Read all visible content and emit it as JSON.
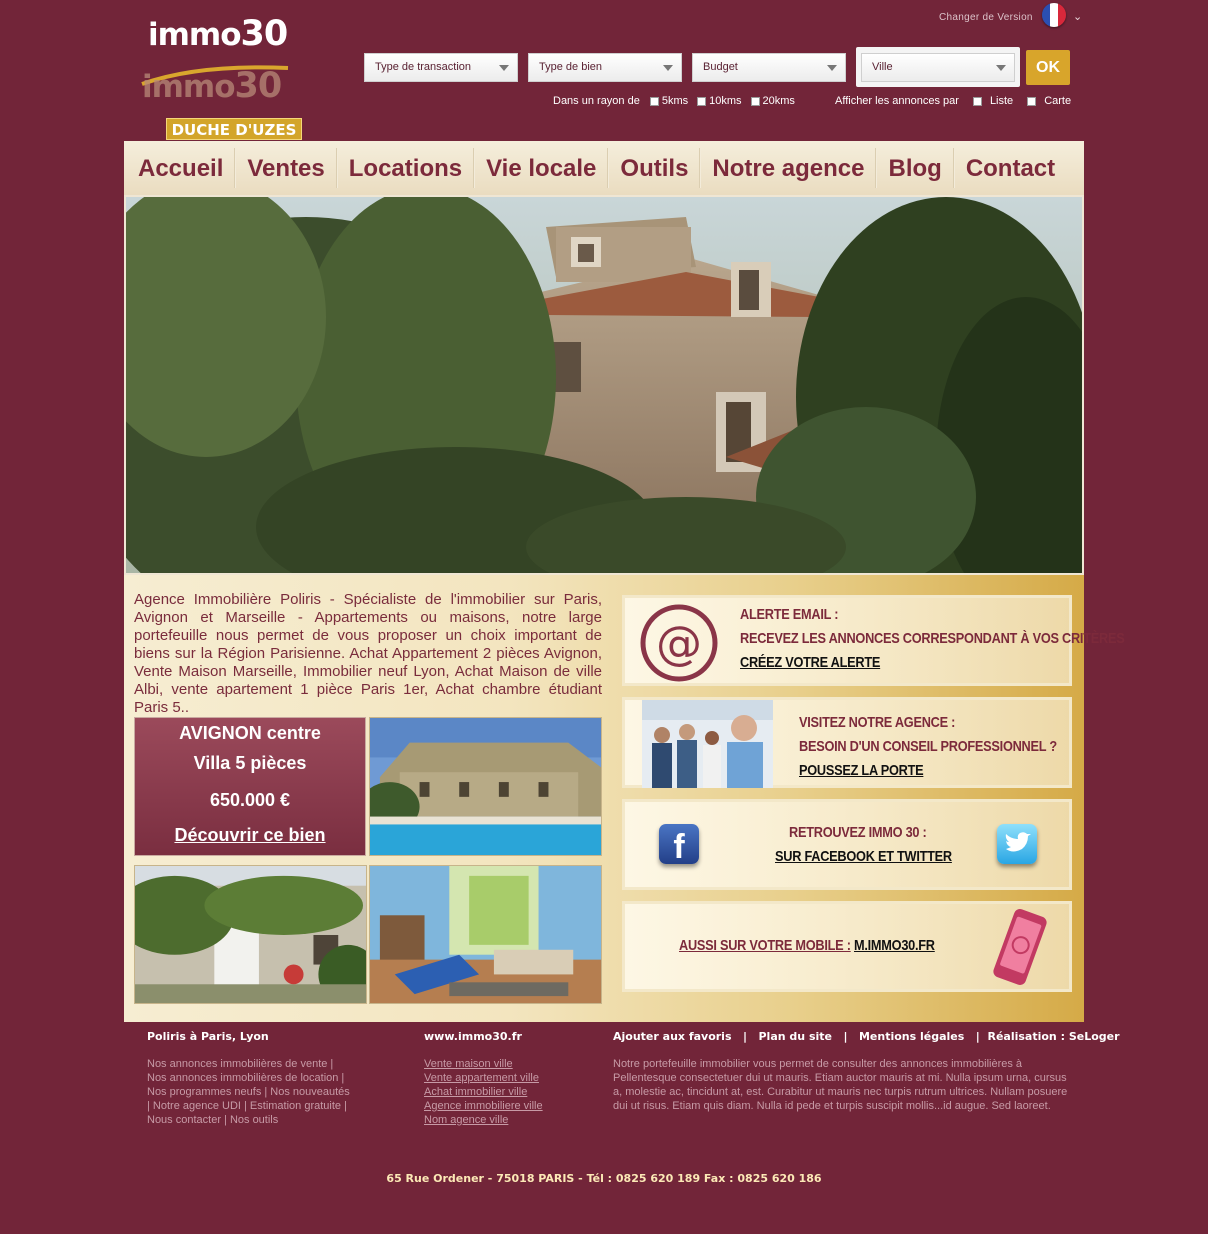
{
  "header": {
    "logo": {
      "name_top": "immo",
      "num_top": "30",
      "name_bottom": "immo",
      "num_bottom": "30",
      "city": "DUCHE D'UZES"
    },
    "version_label": "Changer de Version",
    "flag_colors": [
      "#2b4fb2",
      "#ffffff",
      "#d8283b"
    ]
  },
  "search": {
    "transaction": "Type de transaction",
    "bien": "Type de bien",
    "budget": "Budget",
    "ville": "Ville",
    "ok": "OK",
    "radius_label": "Dans un rayon de",
    "radius": [
      "5kms",
      "10kms",
      "20kms"
    ],
    "display_label": "Afficher les annonces par",
    "display": [
      "Liste",
      "Carte"
    ]
  },
  "nav": [
    "Accueil",
    "Ventes",
    "Locations",
    "Vie locale",
    "Outils",
    "Notre agence",
    "Blog",
    "Contact"
  ],
  "intro": "Agence Immobilière Poliris - Spécialiste de l'immobilier sur Paris, Avignon et Marseille - Appartements ou maisons, notre large portefeuille nous permet de vous proposer un choix important de biens sur la Région Parisienne. Achat Appartement 2 pièces Avignon, Vente Maison Marseille, Immobilier neuf Lyon, Achat Maison de ville Albi, vente apartement 1 pièce Paris 1er, Achat chambre étudiant Paris 5..",
  "featured": {
    "city": "AVIGNON centre",
    "type": "Villa 5 pièces",
    "price": "650.000 €",
    "cta": "Découvrir ce bien"
  },
  "panels": {
    "alert": {
      "l1": "ALERTE EMAIL :",
      "l2": "RECEVEZ LES ANNONCES CORRESPONDANT À VOS CRITÈRES",
      "l3": "CRÉEZ VOTRE ALERTE"
    },
    "agency": {
      "l1": "VISITEZ NOTRE AGENCE :",
      "l2": "BESOIN D'UN CONSEIL PROFESSIONNEL ?",
      "l3": "POUSSEZ LA PORTE"
    },
    "social": {
      "l1": "RETROUVEZ IMMO 30 :",
      "l2": "SUR FACEBOOK ET TWITTER"
    },
    "mobile": {
      "l1": "AUSSI SUR VOTRE MOBILE :",
      "l2": "M.IMMO30.FR"
    }
  },
  "footer": {
    "col1_title": "Poliris à Paris, Lyon",
    "col1_lines": [
      "Nos annonces immobilières de vente |",
      "Nos annonces immobilières de location |",
      "Nos programmes neufs | Nos nouveautés",
      "| Notre agence UDI | Estimation gratuite |",
      "Nous contacter | Nos outils"
    ],
    "col2_title": "www.immo30.fr",
    "col2_links": [
      "Vente maison ville",
      "Vente appartement ville",
      "Achat immobilier ville",
      "Agence immobiliere ville",
      "Nom agence ville"
    ],
    "col3_title": "Ajouter aux favoris   |   Plan du site   |   Mentions légales   |  Réalisation : SeLoger",
    "col3_text": "Notre portefeuille immobilier vous permet de consulter des annonces immobilières à Pellentesque consectetuer dui ut mauris. Etiam auctor mauris at mi. Nulla ipsum urna, cursus a, molestie ac, tincidunt at, est. Curabitur ut mauris nec turpis rutrum ultrices. Nullam posuere dui ut risus. Etiam quis diam. Nulla id pede et turpis suscipit mollis...id augue. Sed laoreet.",
    "address": "65 Rue Ordener - 75018 PARIS  -  Tél : 0825 620 189  Fax : 0825 620 186"
  }
}
